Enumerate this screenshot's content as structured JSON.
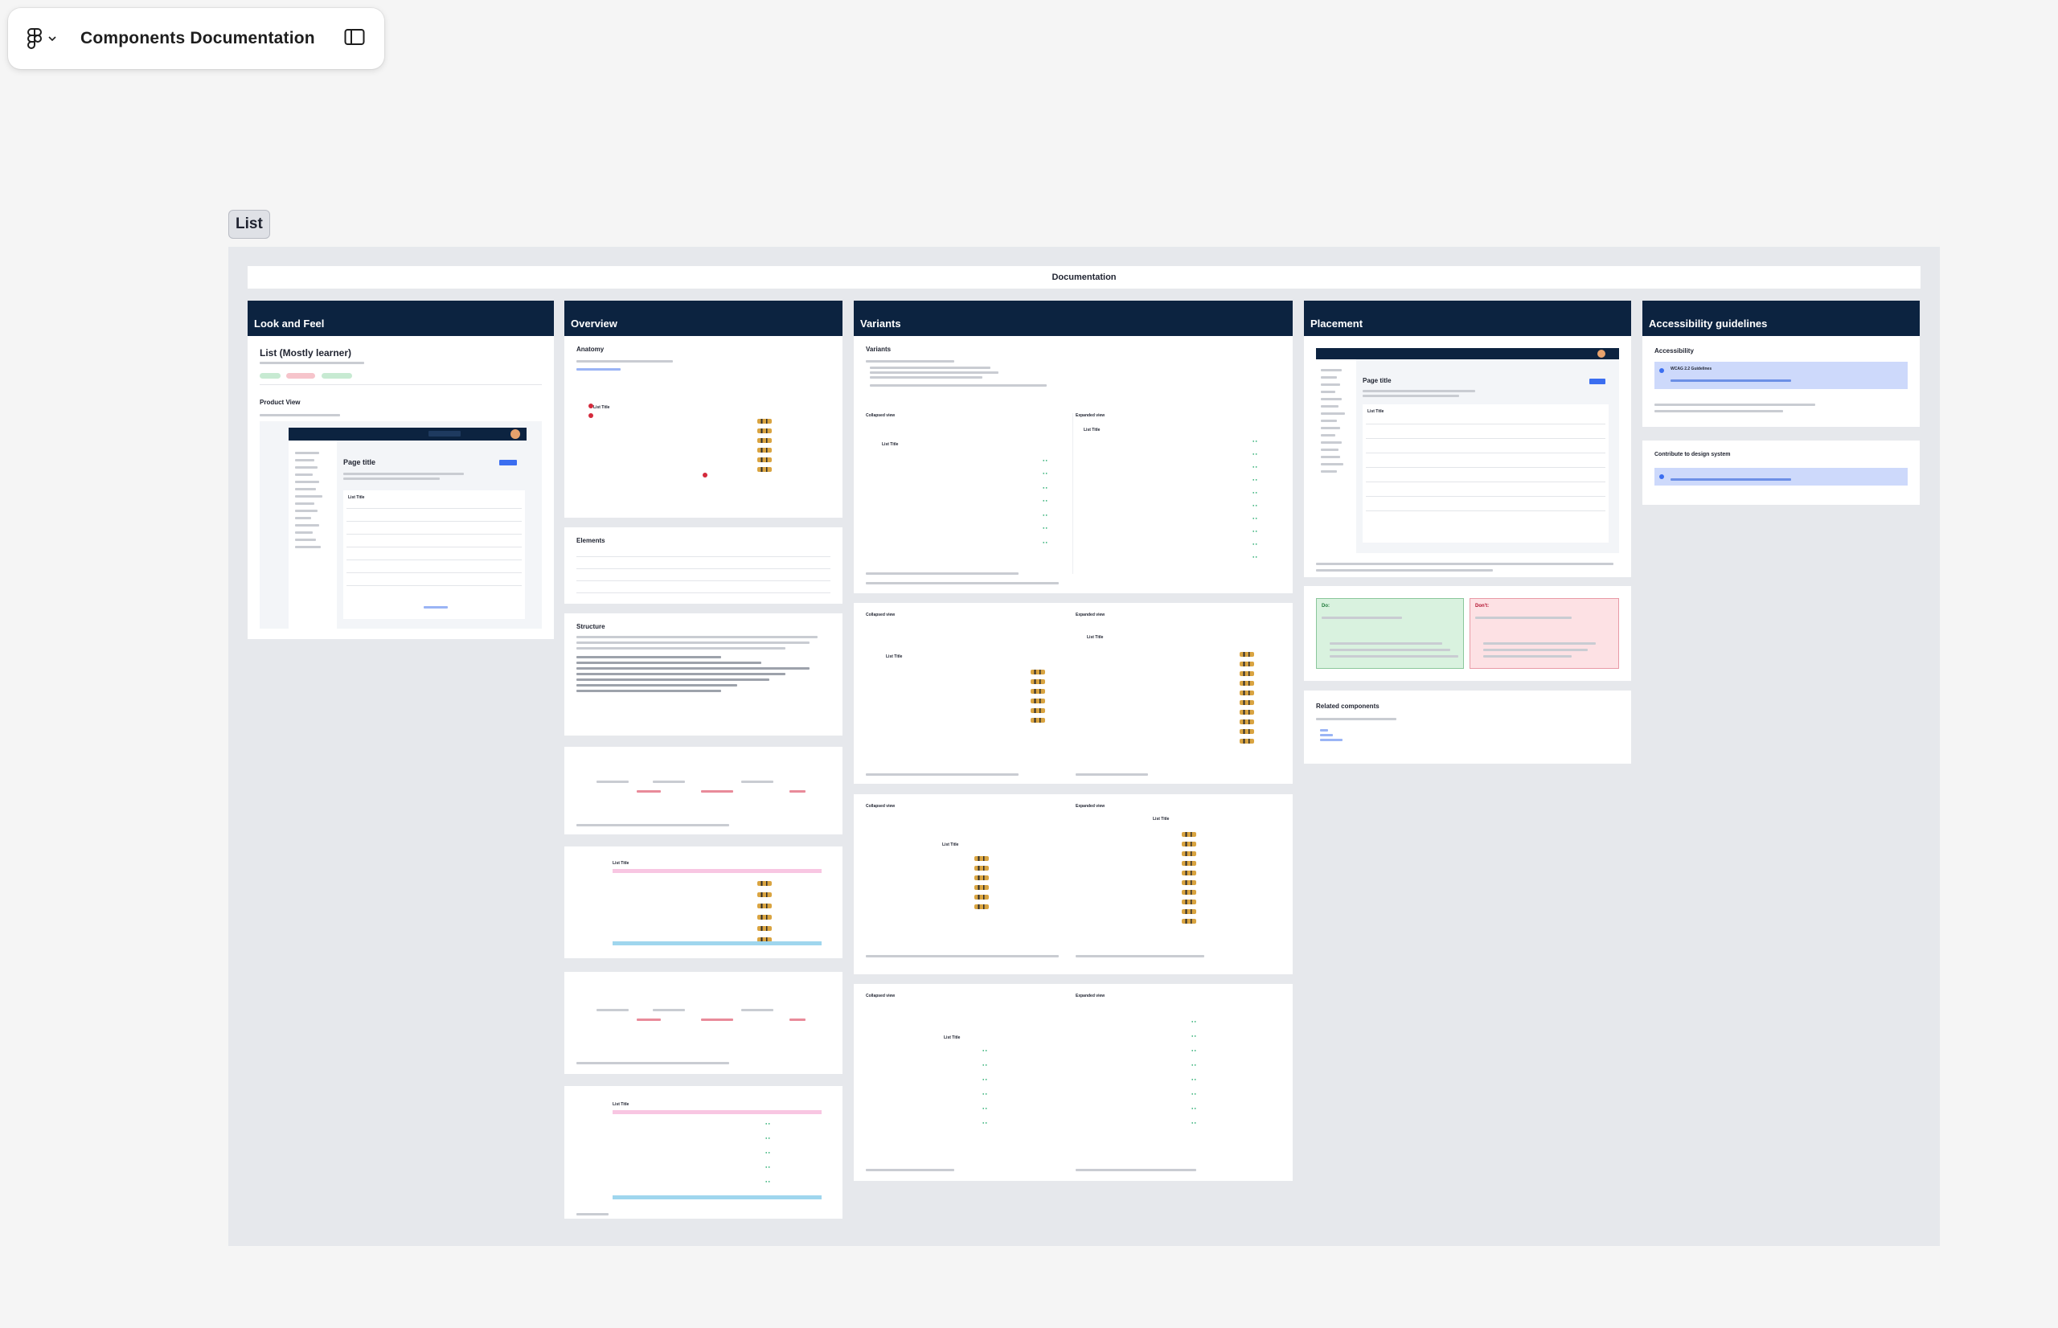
{
  "toolbar": {
    "file_title": "Components Documentation",
    "logo_icon": "figma-logo-icon",
    "menu_icon": "chevron-down-icon",
    "panel_icon": "sidebar-toggle-icon"
  },
  "frame": {
    "label": "List",
    "header": "Documentation"
  },
  "columns": {
    "look_and_feel": {
      "title": "Look and Feel",
      "component_title": "List (Mostly learner)",
      "product_view": "Product View",
      "page_title": "Page title",
      "list_title": "List Title"
    },
    "overview": {
      "title": "Overview",
      "anatomy": "Anatomy",
      "elements": "Elements",
      "structure": "Structure",
      "list_title": "List Title"
    },
    "variants": {
      "title": "Variants",
      "variants_heading": "Variants",
      "collapsed": "Collapsed view",
      "expanded": "Expanded view",
      "list_title": "List Title"
    },
    "placement": {
      "title": "Placement",
      "page_title": "Page title",
      "list_title": "List Title",
      "do": "Do:",
      "dont": "Don't:",
      "related": "Related components"
    },
    "accessibility": {
      "title": "Accessibility guidelines",
      "accessibility": "Accessibility",
      "wcag": "WCAG 2.2 Guidelines",
      "contribute": "Contribute to design system"
    }
  },
  "colors": {
    "header_navy": "#0c2340",
    "accent_blue": "#3b6ef0",
    "success_green": "#39b37b",
    "do_bg": "#d9f2df",
    "dont_bg": "#fde1e4",
    "info_bg": "#cdd9fb"
  }
}
